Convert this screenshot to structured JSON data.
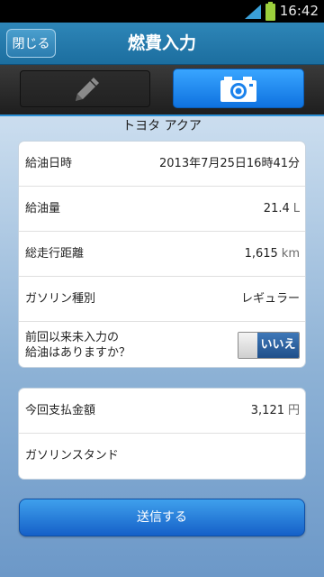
{
  "status_bar": {
    "time": "16:42",
    "signal_icon": "signal-icon",
    "battery_icon": "battery-icon"
  },
  "header": {
    "close_label": "閉じる",
    "title": "燃費入力"
  },
  "tabs": [
    {
      "name": "manual-entry",
      "icon": "pencil-icon",
      "selected": false
    },
    {
      "name": "camera",
      "icon": "camera-icon",
      "selected": true
    }
  ],
  "car_name": "トヨタ アクア",
  "fuel_card": {
    "date": {
      "label": "給油日時",
      "value": "2013年7月25日16時41分"
    },
    "amount": {
      "label": "給油量",
      "value": "21.4",
      "unit": "L"
    },
    "odometer": {
      "label": "総走行距離",
      "value": "1,615",
      "unit": "km"
    },
    "fuel_type": {
      "label": "ガソリン種別",
      "value": "レギュラー"
    },
    "unentered": {
      "label_line1": "前回以来未入力の",
      "label_line2": "給油はありますか？",
      "toggle_value": "いいえ"
    }
  },
  "payment_card": {
    "amount": {
      "label": "今回支払金額",
      "value": "3,121",
      "unit": "円"
    },
    "station": {
      "label": "ガソリンスタンド",
      "value": ""
    }
  },
  "submit_label": "送信する",
  "colors": {
    "header": "#1c6e9f",
    "accent": "#2a8fd6",
    "toggle_on": "#1f4f8a"
  }
}
